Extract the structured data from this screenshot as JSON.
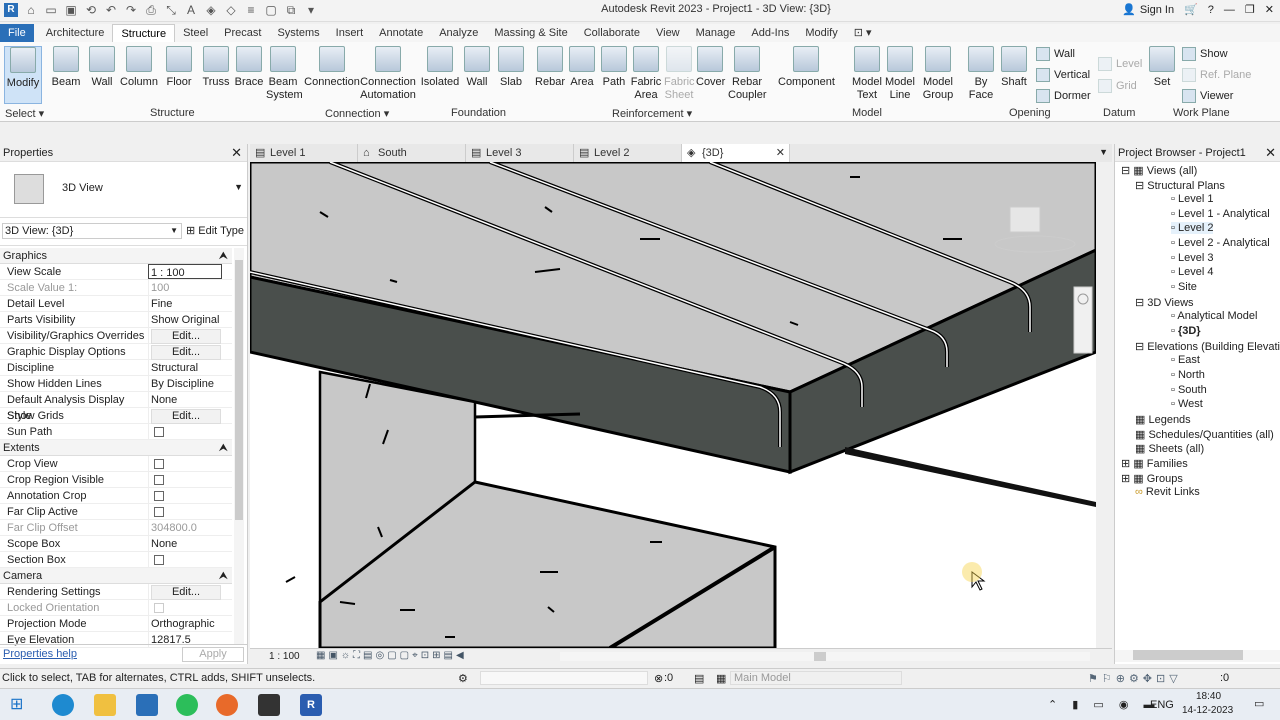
{
  "window_title": "Autodesk Revit 2023 - Project1 - 3D View: {3D}",
  "sign_in": "Sign In",
  "menu_tabs": [
    "File",
    "Architecture",
    "Structure",
    "Steel",
    "Precast",
    "Systems",
    "Insert",
    "Annotate",
    "Analyze",
    "Massing & Site",
    "Collaborate",
    "View",
    "Manage",
    "Add-Ins",
    "Modify"
  ],
  "ribbon": {
    "buttons": [
      "Modify",
      "Beam",
      "Wall",
      "Column",
      "Floor",
      "Truss",
      "Brace",
      "Beam\nSystem",
      "Connection",
      "Connection\nAutomation",
      "Isolated",
      "Wall",
      "Slab",
      "Rebar",
      "Area",
      "Path",
      "Fabric\nArea",
      "Fabric\nSheet",
      "Cover",
      "Rebar\nCoupler",
      "Component",
      "Model\nText",
      "Model\nLine",
      "Model\nGroup",
      "By\nFace",
      "Shaft",
      "Set"
    ],
    "small": {
      "wall": "Wall",
      "vertical": "Vertical",
      "dormer": "Dormer",
      "level": "Level",
      "grid": "Grid",
      "show": "Show",
      "refplane": "Ref. Plane",
      "viewer": "Viewer"
    },
    "panels": [
      "Select",
      "Structure",
      "Connection",
      "Foundation",
      "Reinforcement",
      "Model",
      "Opening",
      "Datum",
      "Work Plane"
    ]
  },
  "properties": {
    "title": "Properties",
    "type_name": "3D View",
    "instance": "3D View: {3D}",
    "edit_type": "Edit Type",
    "sections": {
      "graphics": "Graphics",
      "extents": "Extents",
      "camera": "Camera"
    },
    "rows": [
      {
        "k": "View Scale",
        "v": "1 : 100"
      },
      {
        "k": "Scale Value    1:",
        "v": "100"
      },
      {
        "k": "Detail Level",
        "v": "Fine"
      },
      {
        "k": "Parts Visibility",
        "v": "Show Original"
      },
      {
        "k": "Visibility/Graphics Overrides",
        "v": "Edit..."
      },
      {
        "k": "Graphic Display Options",
        "v": "Edit..."
      },
      {
        "k": "Discipline",
        "v": "Structural"
      },
      {
        "k": "Show Hidden Lines",
        "v": "By Discipline"
      },
      {
        "k": "Default Analysis Display Style",
        "v": "None"
      },
      {
        "k": "Show Grids",
        "v": "Edit..."
      },
      {
        "k": "Sun Path",
        "v": ""
      },
      {
        "k": "Crop View",
        "v": ""
      },
      {
        "k": "Crop Region Visible",
        "v": ""
      },
      {
        "k": "Annotation Crop",
        "v": ""
      },
      {
        "k": "Far Clip Active",
        "v": ""
      },
      {
        "k": "Far Clip Offset",
        "v": "304800.0"
      },
      {
        "k": "Scope Box",
        "v": "None"
      },
      {
        "k": "Section Box",
        "v": ""
      },
      {
        "k": "Rendering Settings",
        "v": "Edit..."
      },
      {
        "k": "Locked Orientation",
        "v": ""
      },
      {
        "k": "Projection Mode",
        "v": "Orthographic"
      },
      {
        "k": "Eye Elevation",
        "v": "12817.5"
      }
    ],
    "help": "Properties help",
    "apply": "Apply"
  },
  "view_tabs": [
    "Level 1",
    "South",
    "Level 3",
    "Level 2",
    "{3D}"
  ],
  "view_scale": "1 : 100",
  "browser": {
    "title": "Project Browser - Project1",
    "items": [
      "Views (all)",
      "Structural Plans",
      "Level 1",
      "Level 1 - Analytical",
      "Level 2",
      "Level 2 - Analytical",
      "Level 3",
      "Level 4",
      "Site",
      "3D Views",
      "Analytical Model",
      "{3D}",
      "Elevations (Building Elevatic",
      "East",
      "North",
      "South",
      "West",
      "Legends",
      "Schedules/Quantities (all)",
      "Sheets (all)",
      "Families",
      "Groups",
      "Revit Links"
    ]
  },
  "status": {
    "hint": "Click to select, TAB for alternates, CTRL adds, SHIFT unselects.",
    "model": "Main Model",
    "zero": ":0"
  },
  "taskbar": {
    "lang": "ENG",
    "time": "18:40",
    "date": "14-12-2023"
  }
}
